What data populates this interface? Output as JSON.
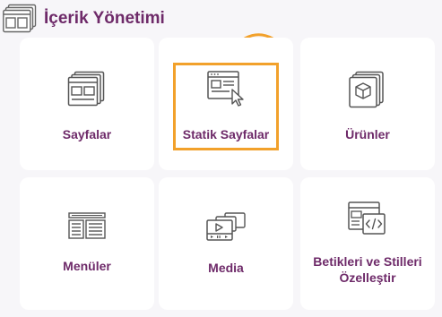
{
  "header": {
    "title": "İçerik Yönetimi",
    "icon": "window-layout-icon"
  },
  "cards": [
    {
      "label": "Sayfalar",
      "icon": "pages-stack-icon",
      "highlighted": false
    },
    {
      "label": "Statik Sayfalar",
      "icon": "static-page-cursor-icon",
      "highlighted": true
    },
    {
      "label": "Ürünler",
      "icon": "product-box-icon",
      "highlighted": false
    },
    {
      "label": "Menüler",
      "icon": "menu-list-icon",
      "highlighted": false
    },
    {
      "label": "Media",
      "icon": "media-player-icon",
      "highlighted": false
    },
    {
      "label": "Betikleri ve Stilleri Özelleştir",
      "icon": "code-window-icon",
      "highlighted": false
    }
  ],
  "colors": {
    "title": "#6e2a69",
    "accent": "#f2a12b",
    "background": "#f7f6f9",
    "card": "#ffffff",
    "icon_stroke": "#555555"
  }
}
